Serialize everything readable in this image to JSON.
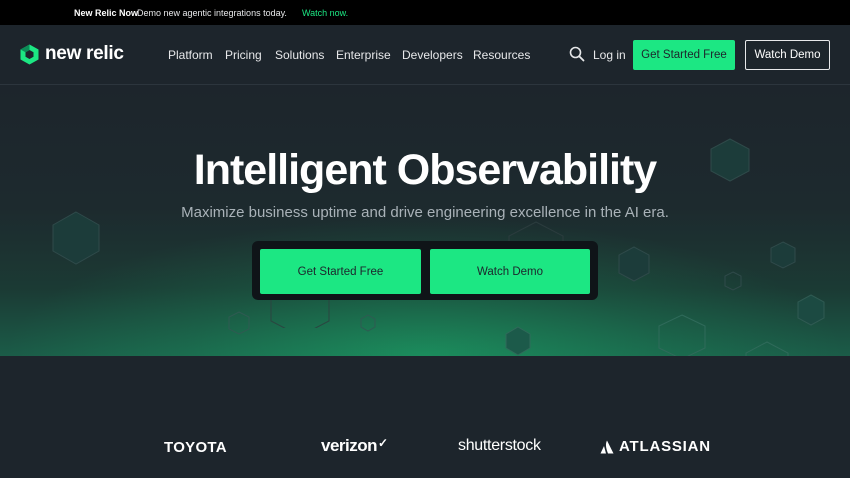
{
  "announcement": {
    "brand": "New Relic Now",
    "message": "Demo new agentic integrations today.",
    "link": "Watch now."
  },
  "nav": {
    "logo_text": "new relic",
    "items": [
      "Platform",
      "Pricing",
      "Solutions",
      "Enterprise",
      "Developers",
      "Resources"
    ],
    "search_icon": "search-icon",
    "login": "Log in",
    "primary_cta": "Get Started Free",
    "secondary_cta": "Watch Demo"
  },
  "hero": {
    "title": "Intelligent Observability",
    "subtitle": "Maximize business uptime and drive engineering excellence in the AI era.",
    "primary_cta": "Get Started Free",
    "secondary_cta": "Watch Demo"
  },
  "customers": {
    "logos": [
      "TOYOTA",
      "verizon",
      "shutterstock",
      "ATLASSIAN"
    ]
  },
  "colors": {
    "accent": "#1ce783",
    "background": "#1d252c",
    "announcement_bg": "#000000"
  }
}
